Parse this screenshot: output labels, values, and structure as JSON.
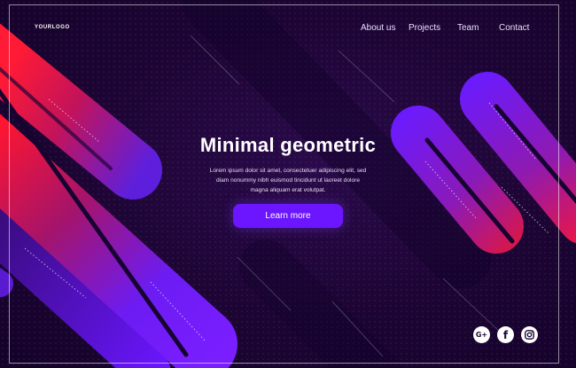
{
  "header": {
    "logo": "YOURLOGO",
    "nav": [
      {
        "label": "About us"
      },
      {
        "label": "Projects"
      },
      {
        "label": "Team"
      },
      {
        "label": "Contact"
      }
    ]
  },
  "hero": {
    "title": "Minimal geometric",
    "body": "Lorem ipsum dolor sit amet, consectetuer adipiscing elit, sed diam nonummy nibh euismod tincidunt ut laoreet dolore magna aliquam erat volutpat.",
    "cta_label": "Learn more"
  },
  "social": [
    {
      "icon": "google-plus-icon",
      "glyph": "G+"
    },
    {
      "icon": "facebook-icon",
      "glyph": "f"
    },
    {
      "icon": "instagram-icon",
      "glyph": ""
    }
  ],
  "colors": {
    "background": "#1e0536",
    "accent": "#6b16ff",
    "red": "#ff1430",
    "purple": "#7a1cff"
  }
}
